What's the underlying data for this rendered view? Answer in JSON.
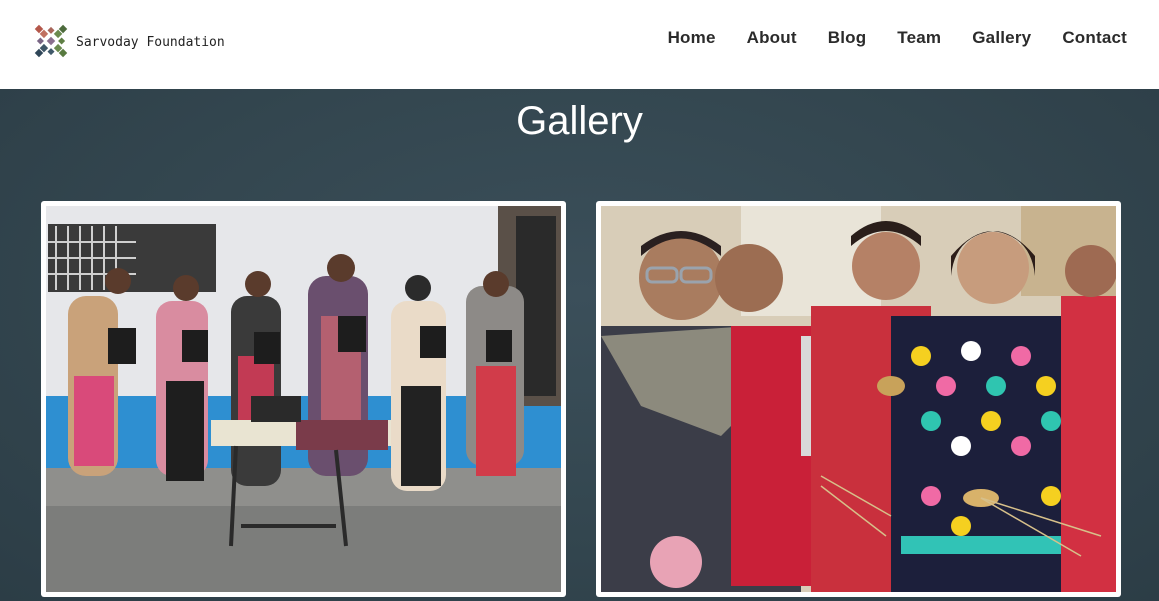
{
  "header": {
    "brand_name": "Sarvoday Foundation",
    "logo_icon": "woven-x-logo-icon",
    "nav": [
      {
        "label": "Home"
      },
      {
        "label": "About"
      },
      {
        "label": "Blog"
      },
      {
        "label": "Team"
      },
      {
        "label": "Gallery"
      },
      {
        "label": "Contact"
      }
    ]
  },
  "gallery": {
    "title": "Gallery",
    "photos": [
      {
        "alt": ""
      },
      {
        "alt": ""
      }
    ]
  },
  "colors": {
    "header_bg": "#ffffff",
    "gallery_bg": "#33464f",
    "nav_text": "#2b2b2b",
    "title_text": "#ffffff",
    "logo_colors": [
      "#b4574a",
      "#6a8a4e",
      "#3f5667",
      "#8a6f8e"
    ]
  }
}
